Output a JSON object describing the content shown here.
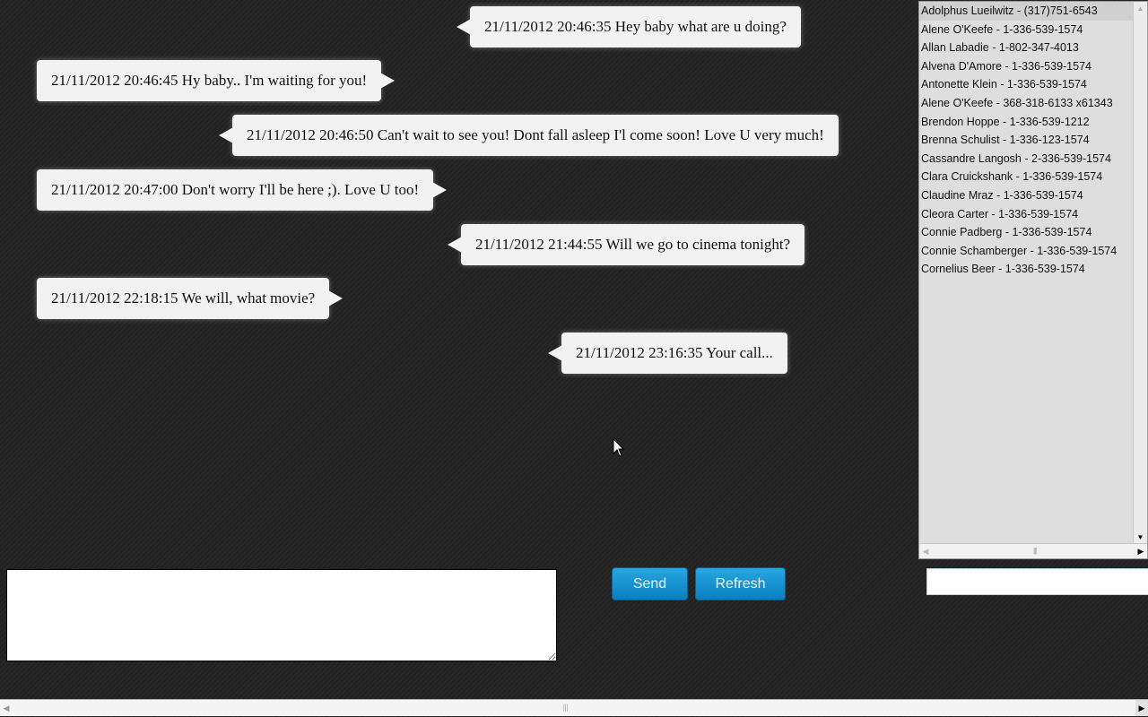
{
  "messages": [
    {
      "side": "right",
      "text": "21/11/2012 20:46:35 Hey baby what are u doing?"
    },
    {
      "side": "left",
      "text": "21/11/2012 20:46:45 Hy baby.. I'm waiting for you!"
    },
    {
      "side": "right",
      "text": "21/11/2012 20:46:50 Can't wait to see you! Dont fall asleep I'l come soon! Love U very much!"
    },
    {
      "side": "left",
      "text": "21/11/2012 20:47:00 Don't worry I'll be here ;). Love U too!"
    },
    {
      "side": "right",
      "text": "21/11/2012 21:44:55 Will we go to cinema tonight?"
    },
    {
      "side": "left",
      "text": "21/11/2012 22:18:15 We will, what movie?"
    },
    {
      "side": "right",
      "text": "21/11/2012 23:16:35 Your call..."
    }
  ],
  "contacts": [
    "Adolphus Lueilwitz - (317)751-6543",
    "Alene O'Keefe - 1-336-539-1574",
    "Allan Labadie - 1-802-347-4013",
    "Alvena D'Amore - 1-336-539-1574",
    "Antonette Klein - 1-336-539-1574",
    "Alene O'Keefe - 368-318-6133 x61343",
    "Brendon Hoppe - 1-336-539-1212",
    "Brenna Schulist - 1-336-123-1574",
    "Cassandre Langosh - 2-336-539-1574",
    "Clara Cruickshank - 1-336-539-1574",
    "Claudine Mraz - 1-336-539-1574",
    "Cleora Carter - 1-336-539-1574",
    "Connie Padberg - 1-336-539-1574",
    "Connie Schamberger - 1-336-539-1574",
    "Cornelius Beer - 1-336-539-1574"
  ],
  "selected_contact_index": 0,
  "message_input": {
    "value": "",
    "placeholder": ""
  },
  "search_input": {
    "value": "",
    "placeholder": ""
  },
  "buttons": {
    "send": "Send",
    "refresh": "Refresh"
  },
  "colors": {
    "button": "#1593d2",
    "bubble": "#f2f2f2",
    "background": "#222222"
  }
}
